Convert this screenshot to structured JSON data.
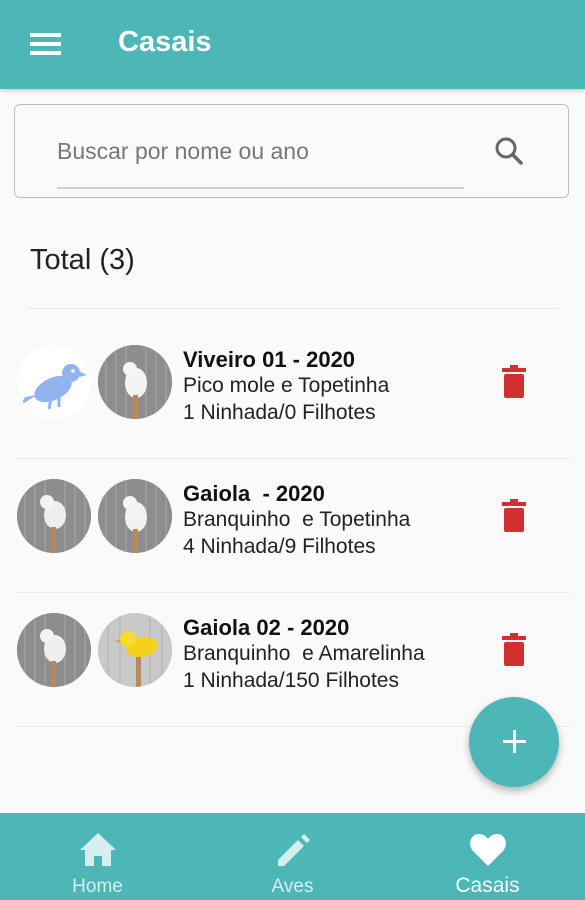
{
  "app_bar": {
    "title": "Casais",
    "menu_icon": "menu-icon",
    "color": "#4db6b6"
  },
  "search": {
    "placeholder": "Buscar por nome ou ano",
    "value": "",
    "icon": "search-icon"
  },
  "list": {
    "total_label": "Total (3)",
    "items": [
      {
        "title": "Viveiro 01 - 2020",
        "birds": "Pico mole e Topetinha",
        "stats": "1 Ninhada/0 Filhotes",
        "avatar_1": "bird-placeholder-icon",
        "avatar_2": "white-canary-photo",
        "delete_icon": "trash-icon"
      },
      {
        "title": "Gaiola  - 2020",
        "birds": "Branquinho  e Topetinha",
        "stats": "4 Ninhada/9 Filhotes",
        "avatar_1": "white-canary-photo",
        "avatar_2": "white-canary-photo",
        "delete_icon": "trash-icon"
      },
      {
        "title": "Gaiola 02 - 2020",
        "birds": "Branquinho  e Amarelinha",
        "stats": "1 Ninhada/150 Filhotes",
        "avatar_1": "white-canary-photo",
        "avatar_2": "yellow-canary-photo",
        "delete_icon": "trash-icon"
      }
    ]
  },
  "fab": {
    "icon": "plus-icon"
  },
  "bottom_nav": {
    "items": [
      {
        "label": "Home",
        "icon": "home-icon",
        "active": false
      },
      {
        "label": "Aves",
        "icon": "pencil-icon",
        "active": false
      },
      {
        "label": "Casais",
        "icon": "heart-icon",
        "active": true
      }
    ]
  },
  "colors": {
    "primary": "#4db6b6",
    "delete": "#d32f2f",
    "placeholder_bird": "#8fb4f0"
  }
}
